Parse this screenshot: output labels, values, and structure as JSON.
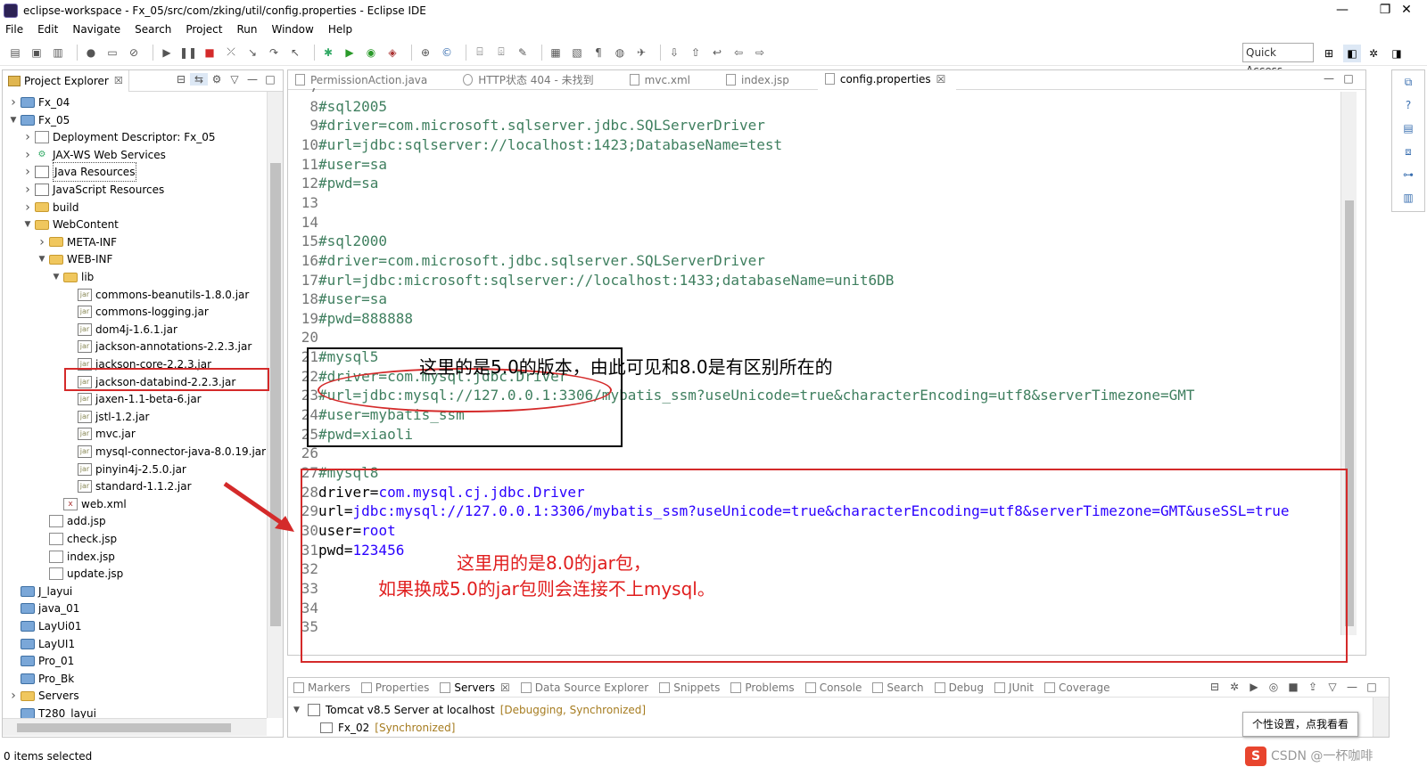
{
  "window": {
    "title": "eclipse-workspace - Fx_05/src/com/zking/util/config.properties - Eclipse IDE",
    "minimize": "—",
    "maximize": "❐",
    "close": "✕"
  },
  "menu": [
    "File",
    "Edit",
    "Navigate",
    "Search",
    "Project",
    "Run",
    "Window",
    "Help"
  ],
  "toolbar": {
    "quick_access": "Quick Access"
  },
  "explorer": {
    "tab_label": "Project Explorer",
    "tab_close": "☒",
    "items": [
      {
        "label": "Fx_04",
        "depth": 0,
        "expanded": false,
        "icon": "project-icon"
      },
      {
        "label": "Fx_05",
        "depth": 0,
        "expanded": true,
        "icon": "project-icon"
      },
      {
        "label": "Deployment Descriptor: Fx_05",
        "depth": 1,
        "expanded": false,
        "icon": "descriptor-icon"
      },
      {
        "label": "JAX-WS Web Services",
        "depth": 1,
        "expanded": false,
        "icon": "webservice-icon"
      },
      {
        "label": "Java Resources",
        "depth": 1,
        "expanded": false,
        "icon": "java-resources-icon"
      },
      {
        "label": "JavaScript Resources",
        "depth": 1,
        "expanded": false,
        "icon": "js-resources-icon"
      },
      {
        "label": "build",
        "depth": 1,
        "expanded": false,
        "icon": "folder-icon"
      },
      {
        "label": "WebContent",
        "depth": 1,
        "expanded": true,
        "icon": "folder-icon"
      },
      {
        "label": "META-INF",
        "depth": 2,
        "expanded": false,
        "icon": "folder-icon"
      },
      {
        "label": "WEB-INF",
        "depth": 2,
        "expanded": true,
        "icon": "folder-icon"
      },
      {
        "label": "lib",
        "depth": 3,
        "expanded": true,
        "icon": "folder-icon"
      },
      {
        "label": "commons-beanutils-1.8.0.jar",
        "depth": 4,
        "icon": "jar-icon"
      },
      {
        "label": "commons-logging.jar",
        "depth": 4,
        "icon": "jar-icon"
      },
      {
        "label": "dom4j-1.6.1.jar",
        "depth": 4,
        "icon": "jar-icon"
      },
      {
        "label": "jackson-annotations-2.2.3.jar",
        "depth": 4,
        "icon": "jar-icon"
      },
      {
        "label": "jackson-core-2.2.3.jar",
        "depth": 4,
        "icon": "jar-icon"
      },
      {
        "label": "jackson-databind-2.2.3.jar",
        "depth": 4,
        "icon": "jar-icon"
      },
      {
        "label": "jaxen-1.1-beta-6.jar",
        "depth": 4,
        "icon": "jar-icon"
      },
      {
        "label": "jstl-1.2.jar",
        "depth": 4,
        "icon": "jar-icon"
      },
      {
        "label": "mvc.jar",
        "depth": 4,
        "icon": "jar-icon"
      },
      {
        "label": "mysql-connector-java-8.0.19.jar",
        "depth": 4,
        "icon": "jar-icon"
      },
      {
        "label": "pinyin4j-2.5.0.jar",
        "depth": 4,
        "icon": "jar-icon"
      },
      {
        "label": "standard-1.1.2.jar",
        "depth": 4,
        "icon": "jar-icon"
      },
      {
        "label": "web.xml",
        "depth": 3,
        "icon": "xml-file-icon"
      },
      {
        "label": "add.jsp",
        "depth": 2,
        "icon": "jsp-file-icon"
      },
      {
        "label": "check.jsp",
        "depth": 2,
        "icon": "jsp-file-icon"
      },
      {
        "label": "index.jsp",
        "depth": 2,
        "icon": "jsp-file-icon"
      },
      {
        "label": "update.jsp",
        "depth": 2,
        "icon": "jsp-file-icon"
      },
      {
        "label": "J_layui",
        "depth": 0,
        "icon": "closed-project-icon"
      },
      {
        "label": "java_01",
        "depth": 0,
        "icon": "closed-project-icon"
      },
      {
        "label": "LayUi01",
        "depth": 0,
        "icon": "closed-project-icon"
      },
      {
        "label": "LayUI1",
        "depth": 0,
        "icon": "closed-project-icon"
      },
      {
        "label": "Pro_01",
        "depth": 0,
        "icon": "closed-project-icon"
      },
      {
        "label": "Pro_Bk",
        "depth": 0,
        "icon": "closed-project-icon"
      },
      {
        "label": "Servers",
        "depth": 0,
        "expanded": false,
        "icon": "servers-folder-icon"
      },
      {
        "label": "T280_layui",
        "depth": 0,
        "icon": "closed-project-icon"
      }
    ]
  },
  "editor": {
    "tabs": [
      {
        "label": "PermissionAction.java",
        "active": false
      },
      {
        "label": "HTTP状态 404 - 未找到",
        "active": false
      },
      {
        "label": "mvc.xml",
        "active": false
      },
      {
        "label": "index.jsp",
        "active": false
      },
      {
        "label": "config.properties",
        "active": true
      }
    ],
    "lines": [
      {
        "n": "7",
        "key": "",
        "val": ""
      },
      {
        "n": "8",
        "key": "#sql2005",
        "val": "",
        "comment": true
      },
      {
        "n": "9",
        "key": "#driver=com.microsoft.sqlserver.jdbc.SQLServerDriver",
        "val": "",
        "comment": true
      },
      {
        "n": "10",
        "key": "#url=jdbc:sqlserver://localhost:1423;DatabaseName=test",
        "val": "",
        "comment": true
      },
      {
        "n": "11",
        "key": "#user=sa",
        "val": "",
        "comment": true
      },
      {
        "n": "12",
        "key": "#pwd=sa",
        "val": "",
        "comment": true
      },
      {
        "n": "13",
        "key": "",
        "val": ""
      },
      {
        "n": "14",
        "key": "",
        "val": ""
      },
      {
        "n": "15",
        "key": "#sql2000",
        "val": "",
        "comment": true
      },
      {
        "n": "16",
        "key": "#driver=com.microsoft.jdbc.sqlserver.SQLServerDriver",
        "val": "",
        "comment": true
      },
      {
        "n": "17",
        "key": "#url=jdbc:microsoft:sqlserver://localhost:1433;databaseName=unit6DB",
        "val": "",
        "comment": true
      },
      {
        "n": "18",
        "key": "#user=sa",
        "val": "",
        "comment": true
      },
      {
        "n": "19",
        "key": "#pwd=888888",
        "val": "",
        "comment": true
      },
      {
        "n": "20",
        "key": "",
        "val": ""
      },
      {
        "n": "21",
        "key": "#mysql5",
        "val": "",
        "comment": true
      },
      {
        "n": "22",
        "key": "#driver=com.mysql.jdbc.Driver",
        "val": "",
        "comment": true
      },
      {
        "n": "23",
        "key": "#url=jdbc:mysql://127.0.0.1:3306/mybatis_ssm?useUnicode=true&characterEncoding=utf8&serverTimezone=GMT",
        "val": "",
        "comment": true
      },
      {
        "n": "24",
        "key": "#user=mybatis_ssm",
        "val": "",
        "comment": true
      },
      {
        "n": "25",
        "key": "#pwd=xiaoli",
        "val": "",
        "comment": true
      },
      {
        "n": "26",
        "key": "",
        "val": ""
      },
      {
        "n": "27",
        "key": "#mysql8",
        "val": "",
        "comment": true
      },
      {
        "n": "28",
        "key": "driver=",
        "val": "com.mysql.cj.jdbc.Driver"
      },
      {
        "n": "29",
        "key": "url=",
        "val": "jdbc:mysql://127.0.0.1:3306/mybatis_ssm?useUnicode=true&characterEncoding=utf8&serverTimezone=GMT&useSSL=true"
      },
      {
        "n": "30",
        "key": "user=",
        "val": "root"
      },
      {
        "n": "31",
        "key": "pwd=",
        "val": "123456"
      },
      {
        "n": "32",
        "key": "",
        "val": ""
      },
      {
        "n": "33",
        "key": "",
        "val": ""
      },
      {
        "n": "34",
        "key": "",
        "val": ""
      },
      {
        "n": "35",
        "key": "",
        "val": ""
      }
    ]
  },
  "annotations": {
    "mysql5_note": "这里的是5.0的版本，由此可见和8.0是有区别所在的",
    "mysql8_note_1": "这里用的是8.0的jar包，",
    "mysql8_note_2": "如果换成5.0的jar包则会连接不上mysql。"
  },
  "bottom": {
    "tabs": [
      {
        "label": "Markers",
        "active": false
      },
      {
        "label": "Properties",
        "active": false
      },
      {
        "label": "Servers",
        "active": true
      },
      {
        "label": "Data Source Explorer",
        "active": false
      },
      {
        "label": "Snippets",
        "active": false
      },
      {
        "label": "Problems",
        "active": false
      },
      {
        "label": "Console",
        "active": false
      },
      {
        "label": "Search",
        "active": false
      },
      {
        "label": "Debug",
        "active": false
      },
      {
        "label": "JUnit",
        "active": false
      },
      {
        "label": "Coverage",
        "active": false
      }
    ],
    "server": {
      "name": "Tomcat v8.5 Server at localhost",
      "status": "[Debugging, Synchronized]",
      "child_name": "Fx_02",
      "child_status": "[Synchronized]"
    },
    "tooltip": "个性设置，点我看看"
  },
  "status": {
    "selection": "0 items selected",
    "watermark": "CSDN @一杯咖啡"
  },
  "colors": {
    "comment": "#3f7f5f",
    "value": "#2a00ff",
    "annotation_red": "#e01e1e"
  }
}
